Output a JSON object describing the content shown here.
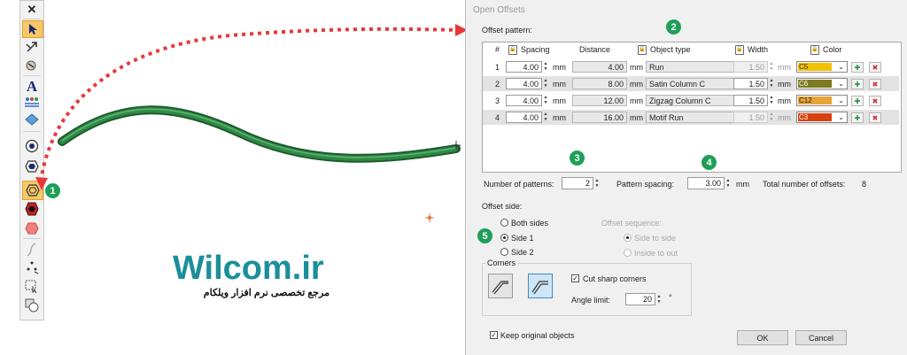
{
  "dialog": {
    "title": "Open Offsets",
    "offset_pattern_label": "Offset pattern:",
    "columns": [
      "#",
      "Spacing",
      "Distance",
      "Object type",
      "Width",
      "Color"
    ],
    "unit": "mm",
    "rows": [
      {
        "num": "1",
        "spacing": "4.00",
        "distance": "4.00",
        "object_type": "Run",
        "width": "1.50",
        "color": "C5",
        "color_hex": "#f2c200"
      },
      {
        "num": "2",
        "spacing": "4.00",
        "distance": "8.00",
        "object_type": "Satin Column C",
        "width": "1.50",
        "color": "C6",
        "color_hex": "#7d7a1f"
      },
      {
        "num": "3",
        "spacing": "4.00",
        "distance": "12.00",
        "object_type": "Zigzag Column C",
        "width": "1.50",
        "color": "C12",
        "color_hex": "#e6a336"
      },
      {
        "num": "4",
        "spacing": "4.00",
        "distance": "16.00",
        "object_type": "Motif Run",
        "width": "1.50",
        "color": "C3",
        "color_hex": "#d9410f"
      }
    ],
    "number_of_patterns_label": "Number of patterns:",
    "number_of_patterns": "2",
    "pattern_spacing_label": "Pattern spacing:",
    "pattern_spacing": "3.00",
    "total_offsets_label": "Total number of offsets:",
    "total_offsets": "8",
    "offset_side_label": "Offset side:",
    "side_options": [
      "Both sides",
      "Side 1",
      "Side 2"
    ],
    "offset_sequence_label": "Offset sequence:",
    "sequence_options": [
      "Side to side",
      "Inside to out"
    ],
    "corners_label": "Corners",
    "cut_sharp_corners": "Cut sharp corners",
    "angle_limit_label": "Angle limit:",
    "angle_limit": "20",
    "degree": "°",
    "keep_original": "Keep original objects",
    "ok": "OK",
    "cancel": "Cancel"
  },
  "callouts": [
    "1",
    "2",
    "3",
    "4",
    "5"
  ],
  "watermark": {
    "brand": "Wilcom.ir",
    "tagline": "مرجع تخصصی نرم افزار ویلکام"
  },
  "colors": {
    "callout": "#1f9f57",
    "arrow": "#e8383a",
    "stitch_line": "#2f8a45",
    "brand_text": "#1a8f9a"
  },
  "toolbar": {
    "close": "✕",
    "icons": [
      "select-arrow-icon",
      "reshape-icon",
      "stitch-icon",
      "lettering-icon",
      "monogram-icon",
      "shape-icon",
      "offset-icon",
      "open-offset-icon",
      "closed-offset-icon",
      "fill-shape-icon",
      "backdrop-icon",
      "curve-icon",
      "dots-icon",
      "node-edit-icon",
      "trim-icon",
      "weld-icon"
    ]
  }
}
